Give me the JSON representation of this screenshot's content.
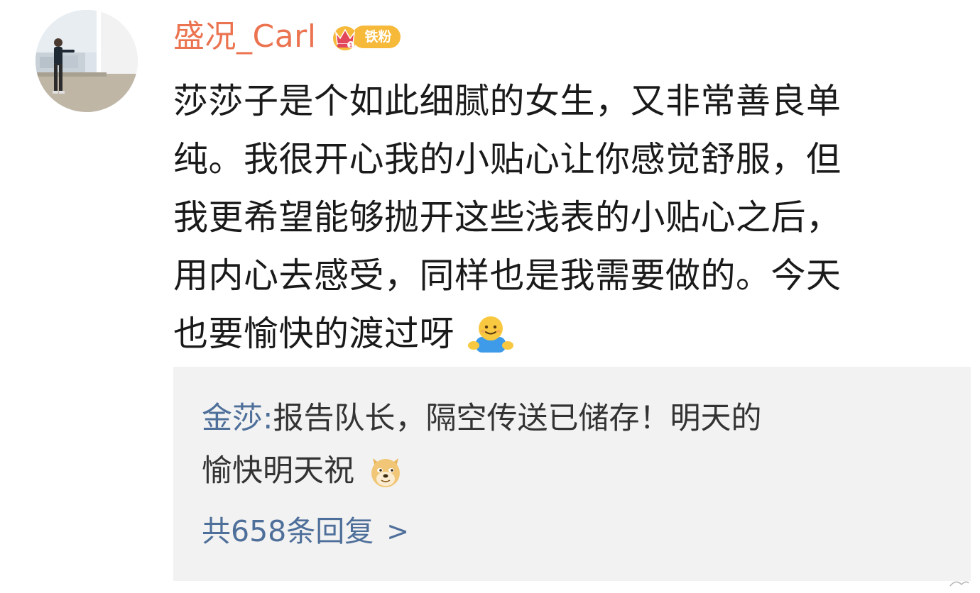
{
  "post": {
    "username": "盛况_Carl",
    "badge_label": "铁粉",
    "badge_level": "1",
    "text_lines": [
      "莎莎子是个如此细腻的女生，又非常善良单",
      "纯。我很开心我的小贴心让你感觉舒服，但",
      "我更希望能够抛开这些浅表的小贴心之后，",
      "用内心去感受，同样也是我需要做的。今天",
      "也要愉快的渡过呀"
    ],
    "emoji_icon": "smiling-person-emoji-icon"
  },
  "reply": {
    "author": "金莎",
    "separator": ": ",
    "line1": "报告队长，隔空传送已储存！明天的",
    "line2": "愉快明天祝",
    "emoji_icon": "doge-emoji-icon",
    "count_text": "共658条回复",
    "chevron": ">"
  },
  "colors": {
    "username": "#eb7350",
    "link": "#4e6f9a",
    "badge": "#f6b93a",
    "reply_bg": "#f2f2f2",
    "text": "#1a1a1a"
  }
}
